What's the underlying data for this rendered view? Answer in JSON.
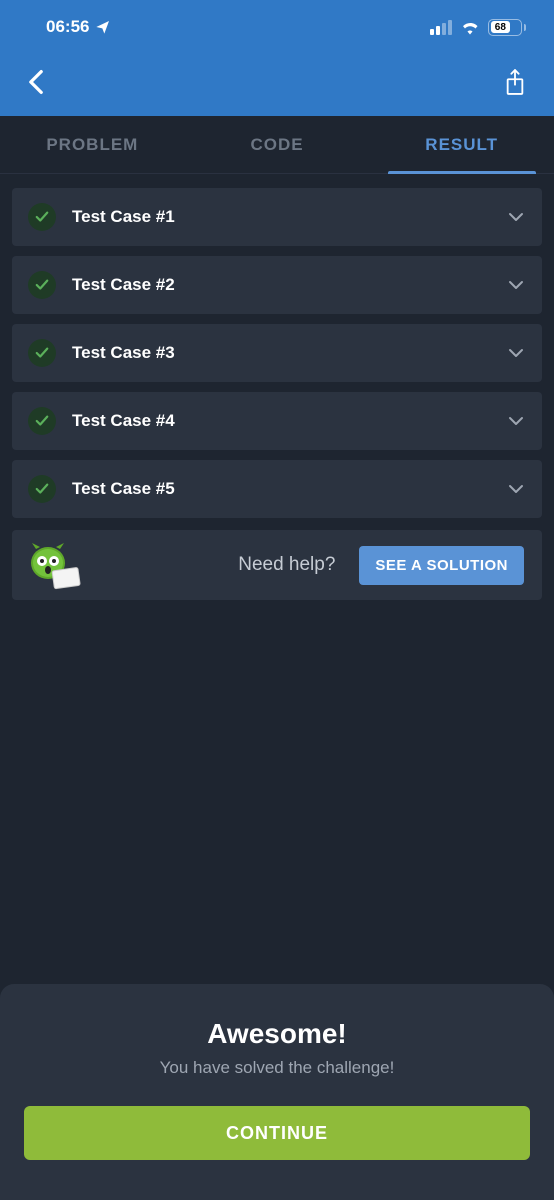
{
  "status_bar": {
    "time": "06:56",
    "battery_percent": "68"
  },
  "tabs": {
    "problem": "PROBLEM",
    "code": "CODE",
    "result": "RESULT",
    "active": "result"
  },
  "test_cases": [
    {
      "label": "Test Case #1",
      "passed": true
    },
    {
      "label": "Test Case #2",
      "passed": true
    },
    {
      "label": "Test Case #3",
      "passed": true
    },
    {
      "label": "Test Case #4",
      "passed": true
    },
    {
      "label": "Test Case #5",
      "passed": true
    }
  ],
  "help": {
    "text": "Need help?",
    "button": "SEE A SOLUTION"
  },
  "result_card": {
    "title": "Awesome!",
    "subtitle": "You have solved the challenge!",
    "button": "CONTINUE"
  }
}
